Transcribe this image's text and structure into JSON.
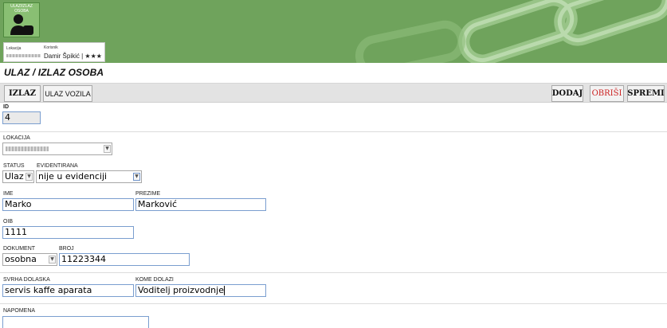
{
  "header": {
    "logo_text": "ULAZ/IZLAZ OSOBA",
    "location_label": "Lokacija",
    "user_label": "Korisnik",
    "user_name": "Damir Špikić | ★★★"
  },
  "page": {
    "title": "ULAZ / IZLAZ OSOBA"
  },
  "toolbar": {
    "izlaz_label": "IZLAZ",
    "ulaz_vozila_label": "ULAZ VOZILA",
    "dodaj_label": "DODAJ",
    "obrisi_label": "OBRIŠI",
    "spremi_label": "SPREMI"
  },
  "form": {
    "id_label": "ID",
    "id_value": "4",
    "lokacija_label": "LOKACIJA",
    "status_label": "STATUS",
    "status_value": "Ulaz",
    "evidentirana_label": "EVIDENTIRANA",
    "evidentirana_value": "nije u evidenciji",
    "ime_label": "IME",
    "ime_value": "Marko",
    "prezime_label": "PREZIME",
    "prezime_value": "Marković",
    "oib_label": "OIB",
    "oib_value": "1111",
    "dokument_label": "DOKUMENT",
    "dokument_value": "osobna",
    "broj_label": "BROJ",
    "broj_value": "11223344",
    "svrha_label": "SVRHA DOLASKA",
    "svrha_value": "servis kaffe aparata",
    "kome_label": "KOME DOLAZI",
    "kome_value": "Voditelj proizvodnje",
    "napomena_label": "NAPOMENA",
    "napomena_value": ""
  },
  "colors": {
    "banner": "#6fa35c",
    "input_border": "#7a9ecf",
    "delete_text": "#cc2222"
  },
  "icons": {
    "logo": "person-badge-icon",
    "banner_decoration": "chain-links"
  }
}
